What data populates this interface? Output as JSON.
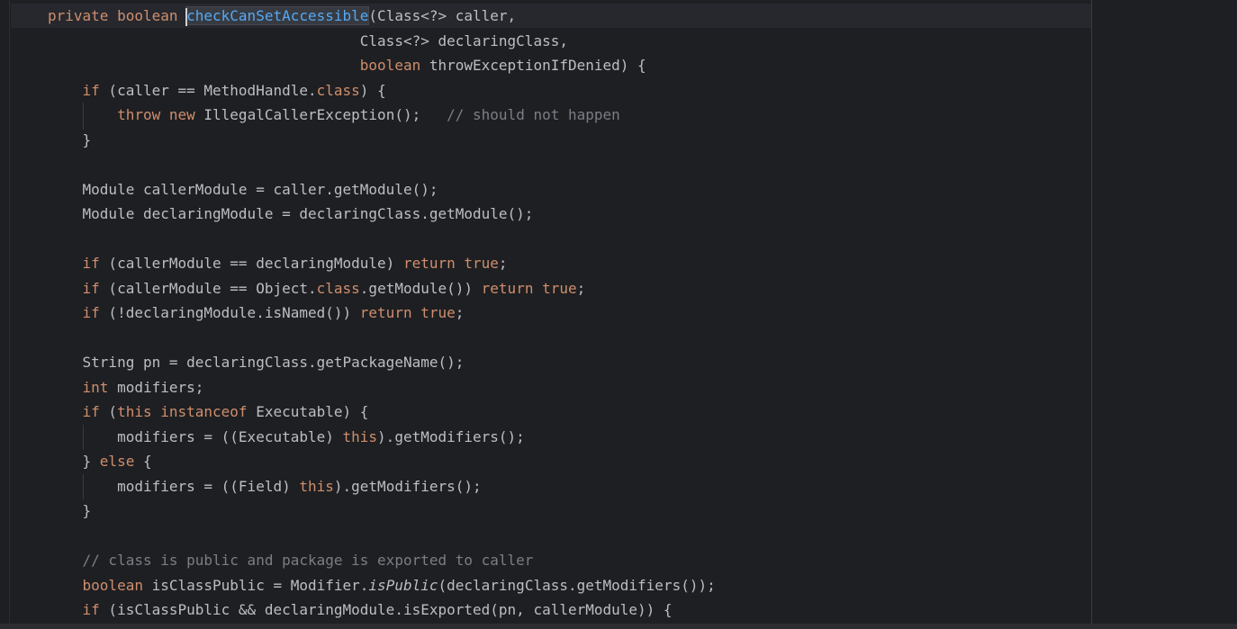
{
  "editor": {
    "language": "Java",
    "caret_line": 1,
    "lines": [
      {
        "segs": [
          [
            "kw",
            "private boolean "
          ],
          [
            "caret",
            ""
          ],
          [
            "fn-decl hl-name",
            "checkCanSetAccessible"
          ],
          [
            "",
            "(Class<?> caller,"
          ]
        ]
      },
      {
        "segs": [
          [
            "",
            "                                    Class<?> declaringClass,"
          ]
        ]
      },
      {
        "segs": [
          [
            "",
            "                                    "
          ],
          [
            "kw",
            "boolean"
          ],
          [
            "",
            " throwExceptionIfDenied) {"
          ]
        ]
      },
      {
        "segs": [
          [
            "",
            "    "
          ],
          [
            "kw",
            "if"
          ],
          [
            "",
            " (caller == MethodHandle."
          ],
          [
            "kw",
            "class"
          ],
          [
            "",
            ") {"
          ]
        ]
      },
      {
        "segs": [
          [
            "",
            "        "
          ],
          [
            "kw",
            "throw new"
          ],
          [
            "",
            " IllegalCallerException();   "
          ],
          [
            "cmt",
            "// should not happen"
          ]
        ]
      },
      {
        "segs": [
          [
            "",
            "    }"
          ]
        ]
      },
      {
        "segs": [
          [
            "",
            ""
          ]
        ]
      },
      {
        "segs": [
          [
            "",
            "    Module callerModule = caller.getModule();"
          ]
        ]
      },
      {
        "segs": [
          [
            "",
            "    Module declaringModule = declaringClass.getModule();"
          ]
        ]
      },
      {
        "segs": [
          [
            "",
            ""
          ]
        ]
      },
      {
        "segs": [
          [
            "",
            "    "
          ],
          [
            "kw",
            "if"
          ],
          [
            "",
            " (callerModule == declaringModule) "
          ],
          [
            "kw",
            "return true"
          ],
          [
            "",
            ";"
          ]
        ]
      },
      {
        "segs": [
          [
            "",
            "    "
          ],
          [
            "kw",
            "if"
          ],
          [
            "",
            " (callerModule == Object."
          ],
          [
            "kw",
            "class"
          ],
          [
            "",
            ".getModule()) "
          ],
          [
            "kw",
            "return true"
          ],
          [
            "",
            ";"
          ]
        ]
      },
      {
        "segs": [
          [
            "",
            "    "
          ],
          [
            "kw",
            "if"
          ],
          [
            "",
            " (!declaringModule.isNamed()) "
          ],
          [
            "kw",
            "return true"
          ],
          [
            "",
            ";"
          ]
        ]
      },
      {
        "segs": [
          [
            "",
            ""
          ]
        ]
      },
      {
        "segs": [
          [
            "",
            "    String pn = declaringClass.getPackageName();"
          ]
        ]
      },
      {
        "segs": [
          [
            "",
            "    "
          ],
          [
            "kw",
            "int"
          ],
          [
            "",
            " modifiers;"
          ]
        ]
      },
      {
        "segs": [
          [
            "",
            "    "
          ],
          [
            "kw",
            "if"
          ],
          [
            "",
            " ("
          ],
          [
            "kw",
            "this instanceof"
          ],
          [
            "",
            " Executable) {"
          ]
        ]
      },
      {
        "segs": [
          [
            "",
            "        modifiers = ((Executable) "
          ],
          [
            "kw",
            "this"
          ],
          [
            "",
            ").getModifiers();"
          ]
        ]
      },
      {
        "segs": [
          [
            "",
            "    } "
          ],
          [
            "kw",
            "else"
          ],
          [
            "",
            " {"
          ]
        ]
      },
      {
        "segs": [
          [
            "",
            "        modifiers = ((Field) "
          ],
          [
            "kw",
            "this"
          ],
          [
            "",
            ").getModifiers();"
          ]
        ]
      },
      {
        "segs": [
          [
            "",
            "    }"
          ]
        ]
      },
      {
        "segs": [
          [
            "",
            ""
          ]
        ]
      },
      {
        "segs": [
          [
            "",
            "    "
          ],
          [
            "cmt",
            "// class is public and package is exported to caller"
          ]
        ]
      },
      {
        "segs": [
          [
            "",
            "    "
          ],
          [
            "kw",
            "boolean"
          ],
          [
            "",
            " isClassPublic = Modifier."
          ],
          [
            "it",
            "isPublic"
          ],
          [
            "",
            "(declaringClass.getModifiers());"
          ]
        ]
      },
      {
        "segs": [
          [
            "",
            "    "
          ],
          [
            "kw",
            "if"
          ],
          [
            "",
            " (isClassPublic && declaringModule.isExported(pn, callerModule)) {"
          ]
        ]
      }
    ]
  }
}
